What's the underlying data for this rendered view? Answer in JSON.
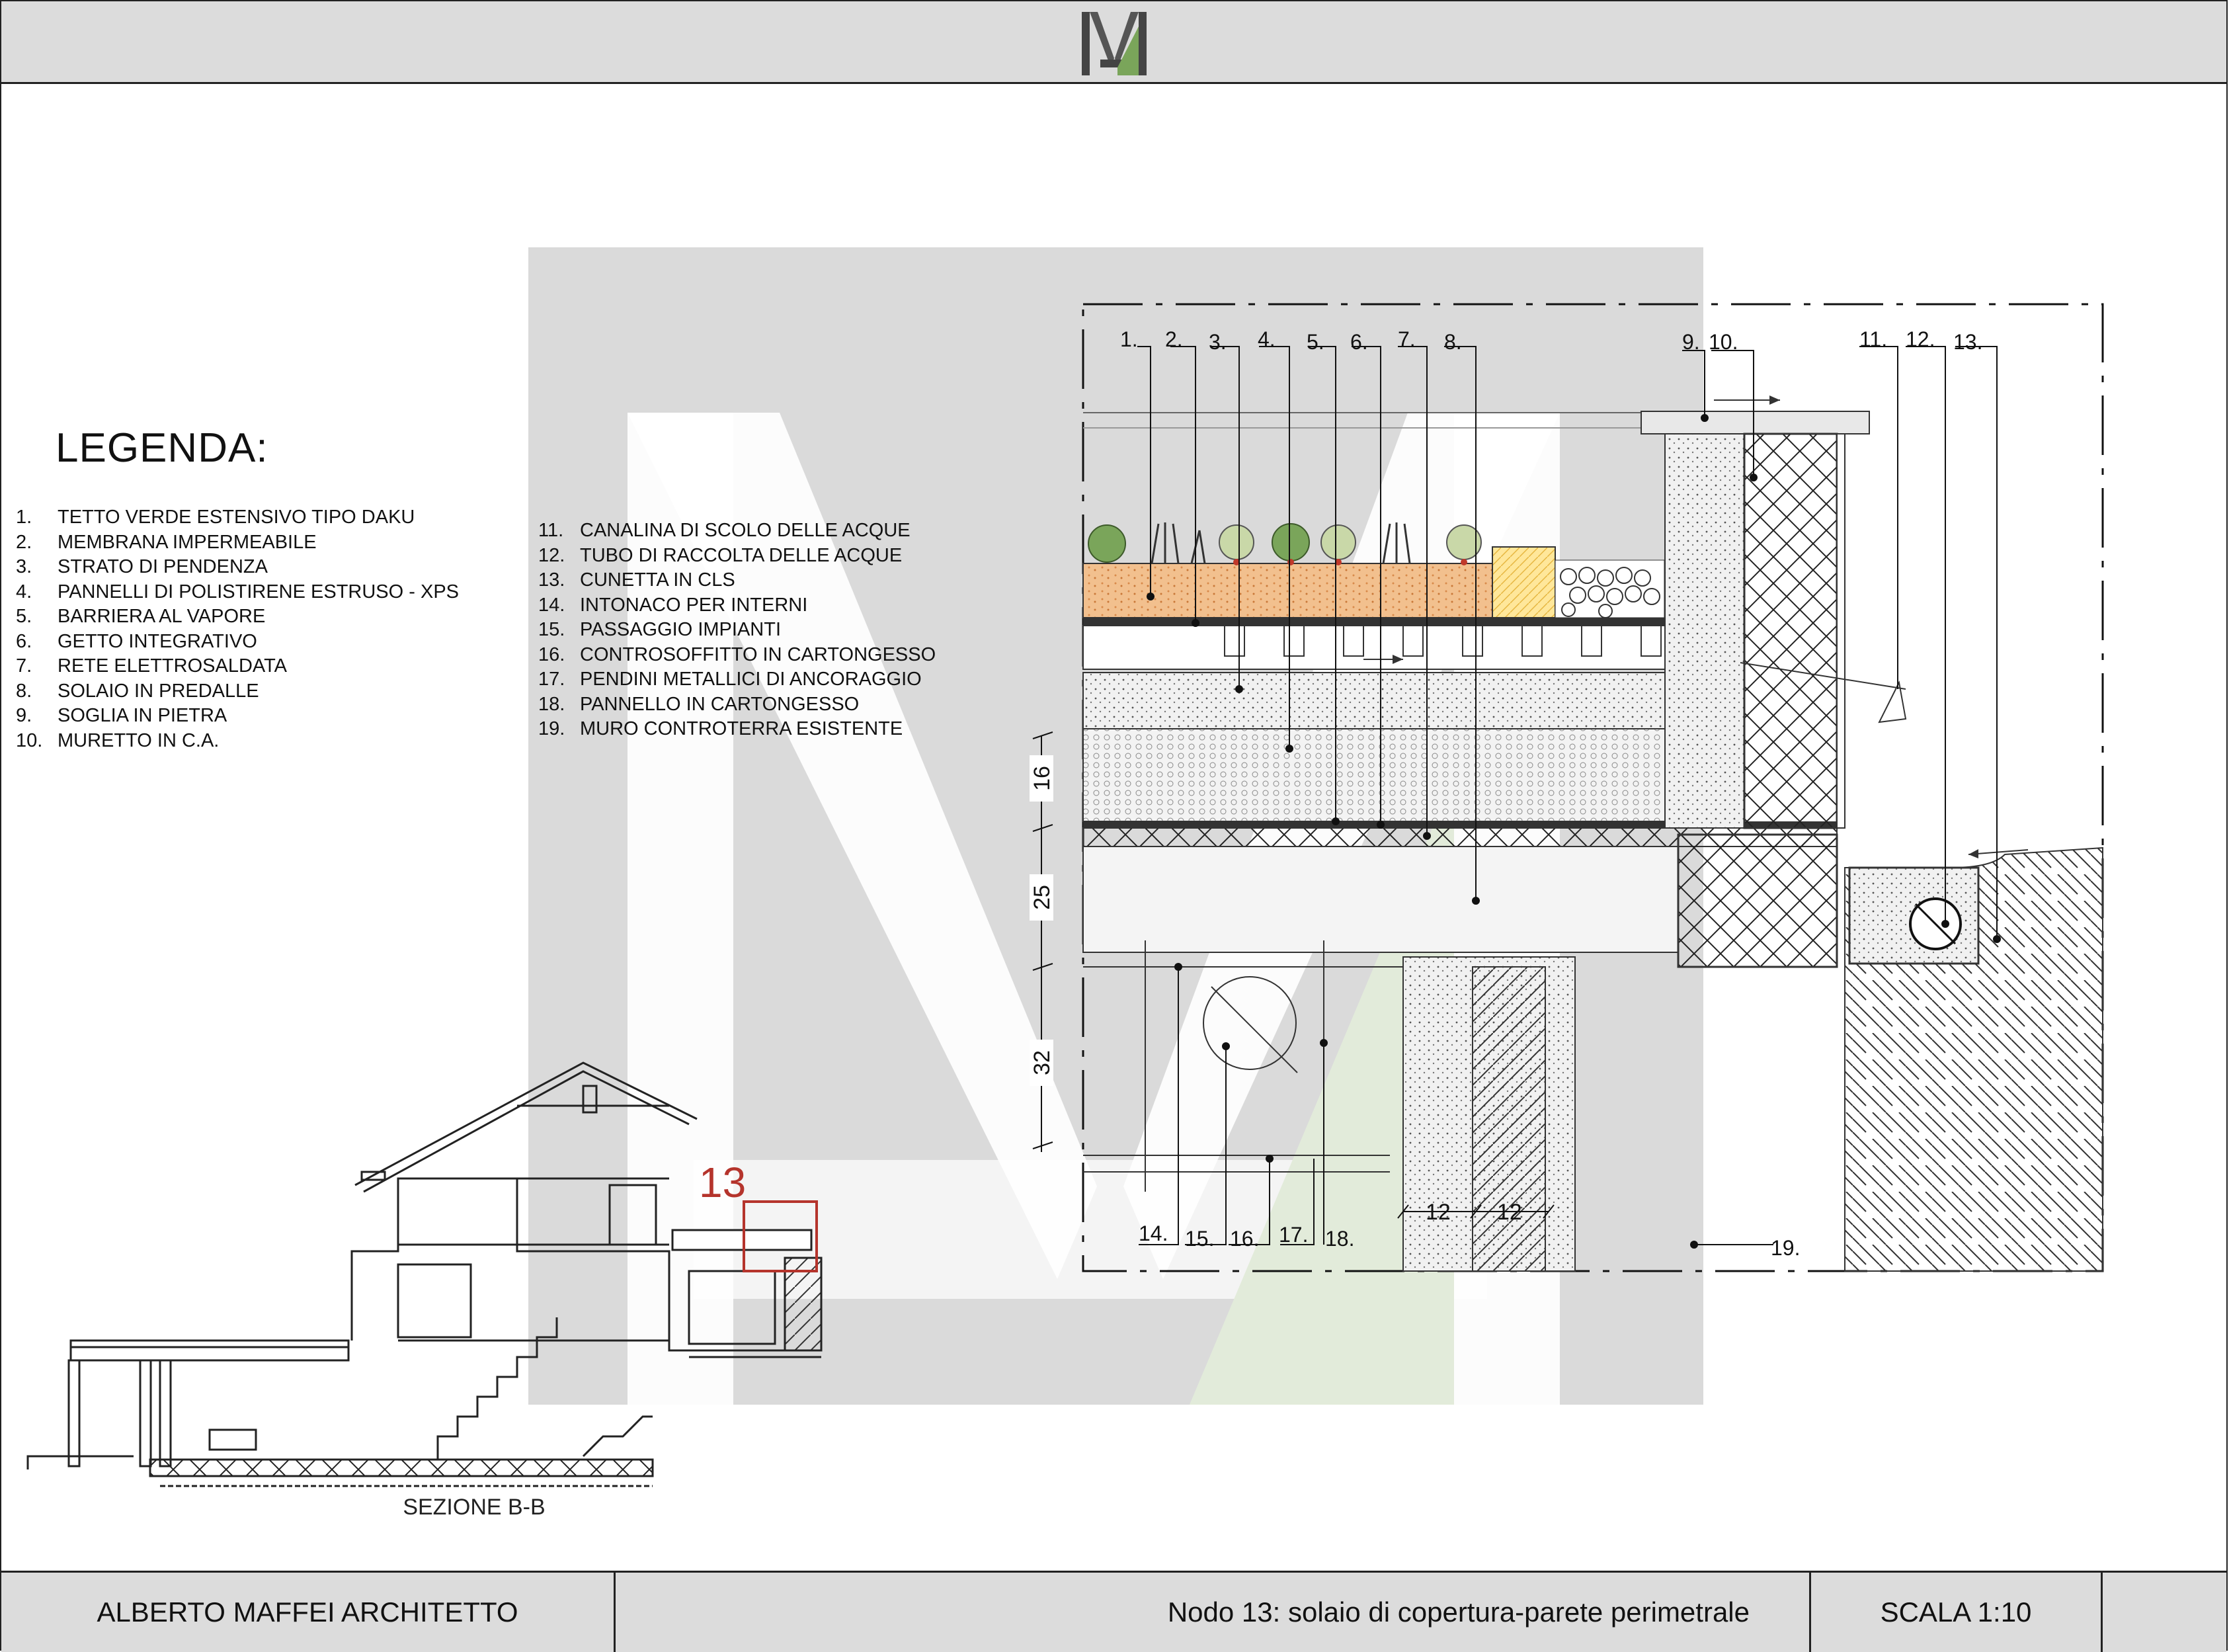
{
  "header": {
    "logo_alt": "M"
  },
  "legend": {
    "title": "LEGENDA:",
    "col1": [
      {
        "n": "1.",
        "text": "TETTO VERDE ESTENSIVO TIPO DAKU"
      },
      {
        "n": "2.",
        "text": "MEMBRANA IMPERMEABILE"
      },
      {
        "n": "3.",
        "text": "STRATO DI PENDENZA"
      },
      {
        "n": "4.",
        "text": "PANNELLI DI POLISTIRENE ESTRUSO - XPS"
      },
      {
        "n": "5.",
        "text": "BARRIERA AL VAPORE"
      },
      {
        "n": "6.",
        "text": "GETTO INTEGRATIVO"
      },
      {
        "n": "7.",
        "text": "RETE ELETTROSALDATA"
      },
      {
        "n": "8.",
        "text": "SOLAIO IN PREDALLE"
      },
      {
        "n": "9.",
        "text": "SOGLIA IN PIETRA"
      },
      {
        "n": "10.",
        "text": "MURETTO IN C.A."
      }
    ],
    "col2": [
      {
        "n": "11.",
        "text": "CANALINA DI SCOLO DELLE ACQUE"
      },
      {
        "n": "12.",
        "text": "TUBO DI RACCOLTA DELLE ACQUE"
      },
      {
        "n": "13.",
        "text": "CUNETTA IN CLS"
      },
      {
        "n": "14.",
        "text": "INTONACO PER INTERNI"
      },
      {
        "n": "15.",
        "text": "PASSAGGIO IMPIANTI"
      },
      {
        "n": "16.",
        "text": "CONTROSOFFITTO IN CARTONGESSO"
      },
      {
        "n": "17.",
        "text": "PENDINI METALLICI DI ANCORAGGIO"
      },
      {
        "n": "18.",
        "text": "PANNELLO IN CARTONGESSO"
      },
      {
        "n": "19.",
        "text": "MURO CONTROTERRA ESISTENTE"
      }
    ]
  },
  "detail": {
    "top_labels": [
      "1.",
      "2.",
      "3.",
      "4.",
      "5.",
      "6.",
      "7.",
      "8.",
      "9.",
      "10.",
      "11.",
      "12.",
      "13."
    ],
    "bottom_labels": [
      "14.",
      "15.",
      "16.",
      "17.",
      "18.",
      "19."
    ],
    "dimensions_vertical": [
      "16",
      "25",
      "32"
    ],
    "dimensions_horizontal": [
      "12",
      "12"
    ]
  },
  "section": {
    "tag": "13",
    "caption": "SEZIONE B-B"
  },
  "colors": {
    "accent_red": "#b5342c",
    "green": "#7aa55a",
    "sheet_gray": "#dcdcdc"
  },
  "footer": {
    "author": "ALBERTO MAFFEI ARCHITETTO",
    "title": "Nodo 13: solaio di copertura-parete perimetrale",
    "scale": "SCALA 1:10"
  }
}
